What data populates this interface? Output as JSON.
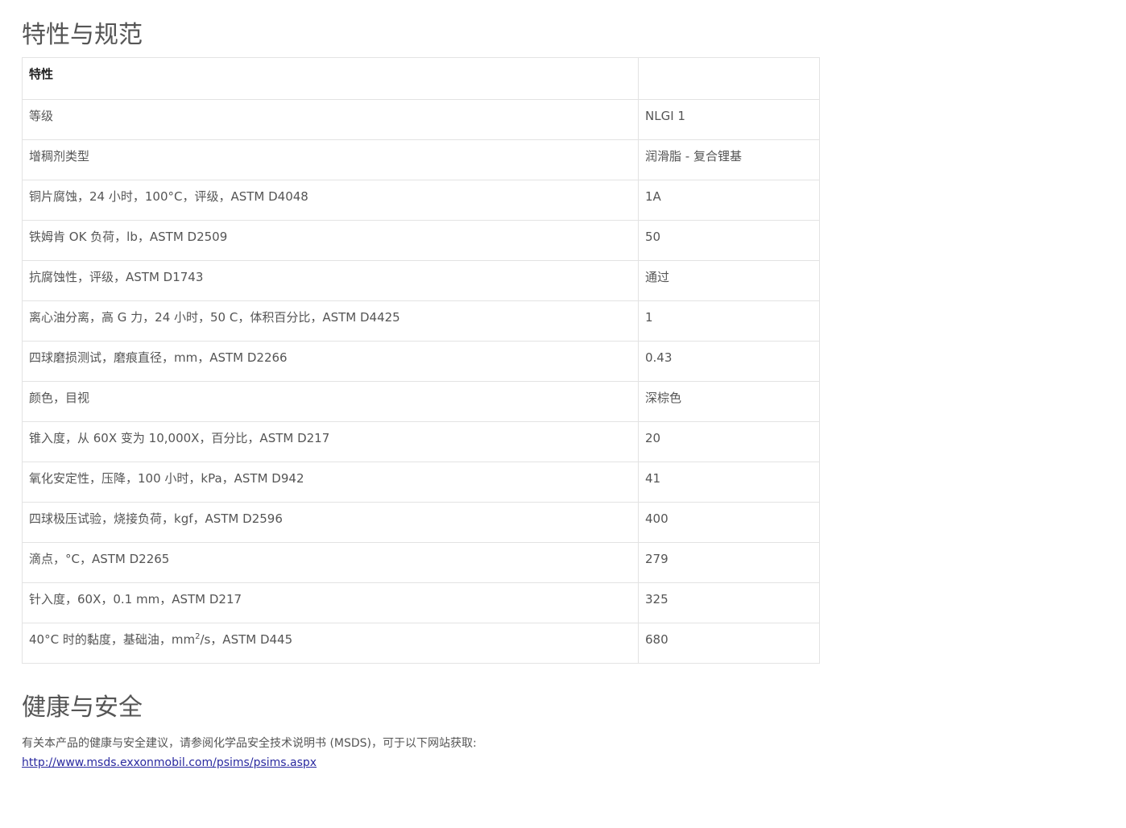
{
  "specs": {
    "title": "特性与规范",
    "header": [
      "特性",
      ""
    ],
    "rows": [
      {
        "property": "等级",
        "value": "NLGI 1"
      },
      {
        "property": "增稠剂类型",
        "value": "润滑脂 - 复合锂基"
      },
      {
        "property": "铜片腐蚀，24 小时，100°C，评级，ASTM D4048",
        "value": "1A"
      },
      {
        "property": "铁姆肯 OK 负荷，lb，ASTM D2509",
        "value": "50"
      },
      {
        "property": "抗腐蚀性，评级，ASTM D1743",
        "value": "通过"
      },
      {
        "property": "离心油分离，高 G 力，24 小时，50 C，体积百分比，ASTM D4425",
        "value": "1"
      },
      {
        "property": "四球磨损测试，磨痕直径，mm，ASTM D2266",
        "value": "0.43"
      },
      {
        "property": "颜色，目视",
        "value": "深棕色"
      },
      {
        "property": "锥入度，从 60X 变为 10,000X，百分比，ASTM D217",
        "value": "20"
      },
      {
        "property": "氧化安定性，压降，100 小时，kPa，ASTM D942",
        "value": "41"
      },
      {
        "property": "四球极压试验，烧接负荷，kgf，ASTM D2596",
        "value": "400"
      },
      {
        "property": "滴点，°C，ASTM D2265",
        "value": "279"
      },
      {
        "property": "针入度，60X，0.1 mm，ASTM D217",
        "value": "325"
      },
      {
        "property_pre": "40°C 时的黏度，基础油，mm",
        "property_sup": "2",
        "property_post": "/s，ASTM D445",
        "value": "680"
      }
    ]
  },
  "health": {
    "title": "健康与安全",
    "text": "有关本产品的健康与安全建议，请参阅化学品安全技术说明书 (MSDS)，可于以下网站获取:",
    "link": "http://www.msds.exxonmobil.com/psims/psims.aspx"
  }
}
